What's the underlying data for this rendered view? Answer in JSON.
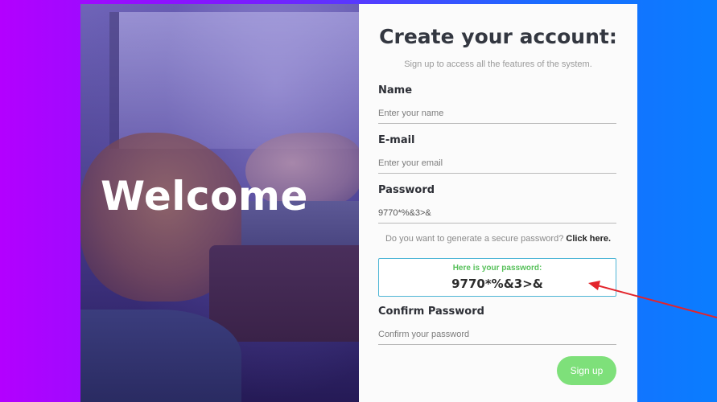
{
  "hero": {
    "welcome_text": "Welcome"
  },
  "form": {
    "title": "Create your account:",
    "subtitle": "Sign up to access all the features of the system.",
    "name": {
      "label": "Name",
      "placeholder": "Enter your name",
      "value": ""
    },
    "email": {
      "label": "E-mail",
      "placeholder": "Enter your email",
      "value": ""
    },
    "password": {
      "label": "Password",
      "value": "9770*%&3>&"
    },
    "generate": {
      "prompt": "Do you want to generate a secure password?",
      "link_label": "Click here."
    },
    "generated": {
      "label": "Here is your password:",
      "value": "9770*%&3>&"
    },
    "confirm_password": {
      "label": "Confirm Password",
      "placeholder": "Confirm your password",
      "value": ""
    },
    "signup_label": "Sign up"
  },
  "colors": {
    "background_start": "#b300ff",
    "background_end": "#0a7dff",
    "generated_border": "#4eb6d6",
    "generated_label": "#57c05a",
    "signup_button": "#7ee07a",
    "annotation_arrow": "#e3242b"
  }
}
